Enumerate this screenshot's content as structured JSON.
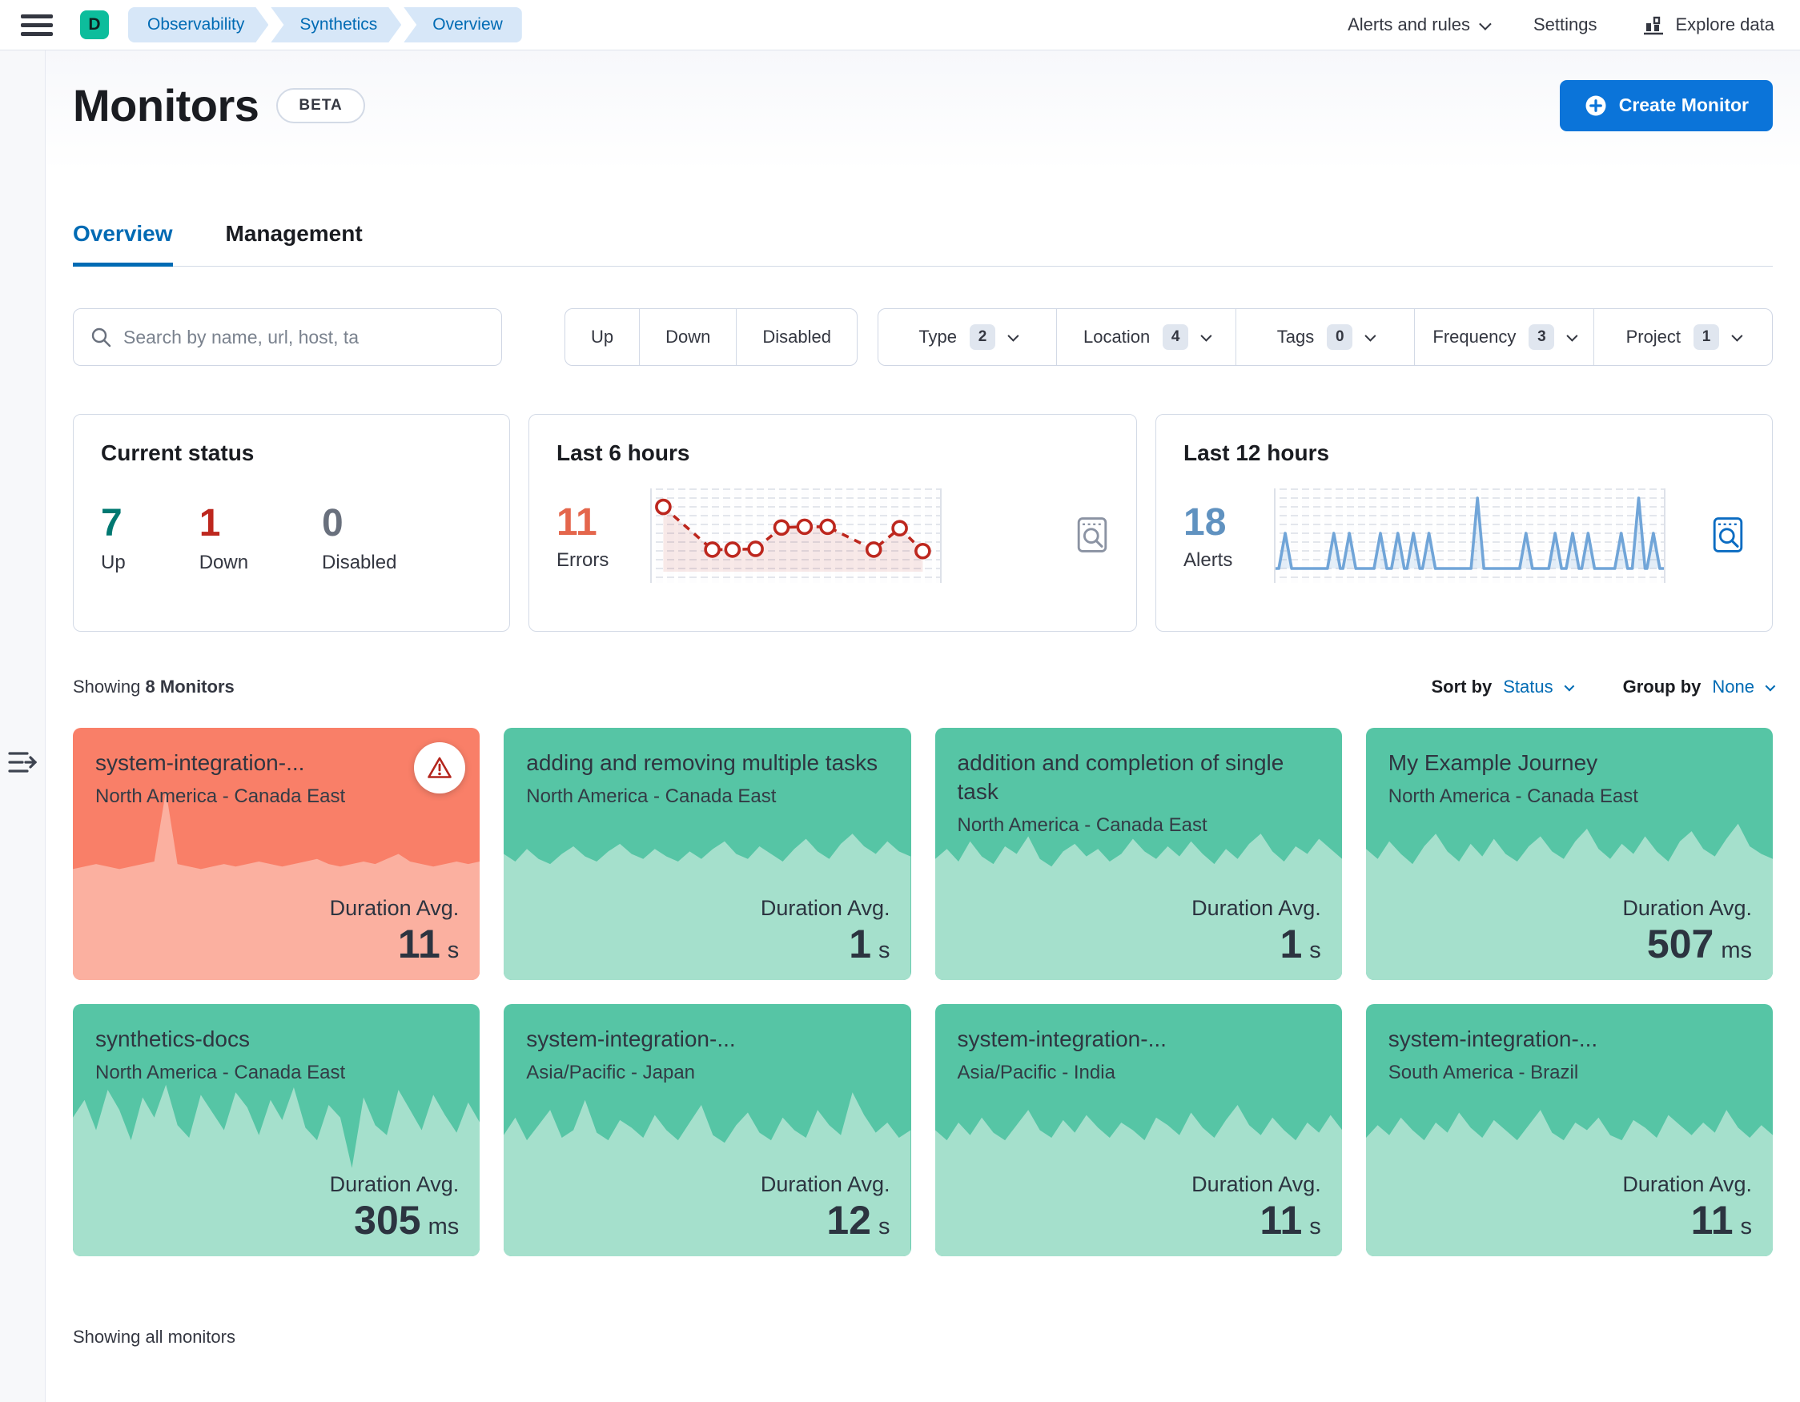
{
  "header": {
    "space_badge": "D",
    "breadcrumbs": [
      {
        "label": "Observability"
      },
      {
        "label": "Synthetics"
      },
      {
        "label": "Overview"
      }
    ],
    "alerts_menu": "Alerts and rules",
    "settings": "Settings",
    "explore_data": "Explore data"
  },
  "page": {
    "title": "Monitors",
    "beta": "BETA",
    "create_monitor": "Create Monitor",
    "tab_overview": "Overview",
    "tab_management": "Management"
  },
  "filters": {
    "search_placeholder": "Search by name, url, host, ta",
    "status": [
      {
        "label": "Up"
      },
      {
        "label": "Down"
      },
      {
        "label": "Disabled"
      }
    ],
    "dropdowns": [
      {
        "label": "Type",
        "count": "2"
      },
      {
        "label": "Location",
        "count": "4"
      },
      {
        "label": "Tags",
        "count": "0"
      },
      {
        "label": "Frequency",
        "count": "3"
      },
      {
        "label": "Project",
        "count": "1"
      }
    ]
  },
  "stats": {
    "current": {
      "title": "Current status",
      "up_value": "7",
      "up_label": "Up",
      "down_value": "1",
      "down_label": "Down",
      "disabled_value": "0",
      "disabled_label": "Disabled"
    },
    "last6": {
      "title": "Last 6 hours",
      "value": "11",
      "label": "Errors",
      "points": [
        [
          4,
          88
        ],
        [
          21,
          30
        ],
        [
          28,
          30
        ],
        [
          36,
          31
        ],
        [
          45,
          60
        ],
        [
          53,
          61
        ],
        [
          61,
          61
        ],
        [
          77,
          30
        ],
        [
          86,
          59
        ],
        [
          94,
          28
        ]
      ]
    },
    "last12": {
      "title": "Last 12 hours",
      "value": "18",
      "label": "Alerts",
      "spikes": [
        [
          2.5,
          5
        ],
        [
          15,
          5
        ],
        [
          19,
          5
        ],
        [
          27,
          5
        ],
        [
          31.5,
          5
        ],
        [
          35.5,
          5
        ],
        [
          39.5,
          5
        ],
        [
          52,
          10
        ],
        [
          64.5,
          5
        ],
        [
          72,
          5
        ],
        [
          76.5,
          5
        ],
        [
          80.5,
          5
        ],
        [
          89,
          5
        ],
        [
          93.5,
          10
        ],
        [
          97.3,
          5
        ]
      ]
    }
  },
  "list": {
    "showing_prefix": "Showing",
    "showing_count": "8 Monitors",
    "sort_by_label": "Sort by",
    "sort_by_value": "Status",
    "group_by_label": "Group by",
    "group_by_value": "None",
    "footer": "Showing all monitors",
    "cards": [
      {
        "title": "system-integration-...",
        "location": "North America - Canada East",
        "metric_label": "Duration Avg.",
        "value": "11",
        "unit": "s",
        "status": "down",
        "spark": [
          44,
          45,
          46,
          45,
          44,
          45,
          46,
          47,
          75,
          46,
          45,
          44,
          45,
          46,
          45,
          46,
          47,
          46,
          45,
          46,
          47,
          48,
          46,
          45,
          46,
          47,
          46,
          48,
          50,
          47,
          46,
          45,
          46,
          47,
          46,
          47
        ]
      },
      {
        "title": "adding and removing multiple tasks",
        "location": "North America - Canada East",
        "metric_label": "Duration Avg.",
        "value": "1",
        "unit": "s",
        "status": "up",
        "spark": [
          50,
          47,
          52,
          48,
          46,
          50,
          53,
          49,
          47,
          51,
          54,
          50,
          48,
          52,
          49,
          47,
          51,
          48,
          52,
          55,
          50,
          48,
          53,
          50,
          47,
          52,
          56,
          51,
          48,
          54,
          58,
          53,
          50,
          55,
          51,
          49
        ]
      },
      {
        "title": "addition and completion of single task",
        "location": "North America - Canada East",
        "metric_label": "Duration Avg.",
        "value": "1",
        "unit": "s",
        "status": "up",
        "spark": [
          48,
          52,
          47,
          55,
          49,
          46,
          53,
          50,
          57,
          48,
          45,
          51,
          54,
          49,
          52,
          47,
          50,
          56,
          51,
          48,
          53,
          49,
          55,
          50,
          46,
          52,
          48,
          54,
          58,
          51,
          47,
          53,
          50,
          56,
          52,
          48
        ]
      },
      {
        "title": "My Example Journey",
        "location": "North America - Canada East",
        "metric_label": "Duration Avg.",
        "value": "507",
        "unit": "ms",
        "status": "up",
        "spark": [
          52,
          48,
          55,
          50,
          46,
          53,
          58,
          51,
          47,
          54,
          49,
          56,
          50,
          47,
          53,
          57,
          51,
          48,
          55,
          60,
          52,
          48,
          54,
          50,
          57,
          51,
          47,
          55,
          59,
          52,
          49,
          56,
          62,
          53,
          50,
          48
        ]
      },
      {
        "title": "synthetics-docs",
        "location": "North America - Canada East",
        "metric_label": "Duration Avg.",
        "value": "305",
        "unit": "ms",
        "status": "up",
        "spark": [
          55,
          62,
          50,
          66,
          58,
          46,
          63,
          55,
          68,
          52,
          47,
          64,
          57,
          50,
          65,
          59,
          48,
          62,
          54,
          67,
          51,
          46,
          60,
          55,
          35,
          63,
          52,
          48,
          66,
          58,
          50,
          64,
          56,
          49,
          61,
          53
        ]
      },
      {
        "title": "system-integration-...",
        "location": "Asia/Pacific - Japan",
        "metric_label": "Duration Avg.",
        "value": "12",
        "unit": "s",
        "status": "up",
        "spark": [
          48,
          55,
          46,
          52,
          58,
          47,
          50,
          62,
          49,
          46,
          54,
          51,
          47,
          56,
          50,
          46,
          53,
          60,
          48,
          45,
          52,
          57,
          49,
          46,
          55,
          50,
          47,
          58,
          52,
          48,
          65,
          56,
          49,
          53,
          47,
          50
        ]
      },
      {
        "title": "system-integration-...",
        "location": "Asia/Pacific - India",
        "metric_label": "Duration Avg.",
        "value": "11",
        "unit": "s",
        "status": "up",
        "spark": [
          50,
          46,
          53,
          48,
          55,
          49,
          46,
          52,
          58,
          50,
          47,
          54,
          49,
          56,
          51,
          47,
          53,
          50,
          46,
          55,
          52,
          48,
          57,
          51,
          47,
          54,
          60,
          52,
          48,
          55,
          50,
          46,
          53,
          49,
          56,
          50
        ]
      },
      {
        "title": "system-integration-...",
        "location": "South America - Brazil",
        "metric_label": "Duration Avg.",
        "value": "11",
        "unit": "s",
        "status": "up",
        "spark": [
          47,
          52,
          48,
          55,
          50,
          46,
          53,
          49,
          57,
          51,
          47,
          54,
          50,
          46,
          52,
          58,
          49,
          46,
          53,
          50,
          55,
          48,
          46,
          54,
          51,
          47,
          56,
          52,
          48,
          53,
          49,
          58,
          51,
          47,
          52,
          48
        ]
      }
    ]
  },
  "colors": {
    "primary_button": "#0b74d9",
    "link_blue": "#006bb4",
    "card_up": "#56c5a5",
    "card_up_area": "#a5e0cc",
    "card_down": "#f97f68",
    "card_down_area": "#fbb0a0",
    "status_up": "#007871",
    "status_down": "#bd271e",
    "status_disabled": "#69707d",
    "errors_accent": "#e4664c",
    "alerts_accent": "#6092c0",
    "space_badge": "#0dbd9c"
  }
}
